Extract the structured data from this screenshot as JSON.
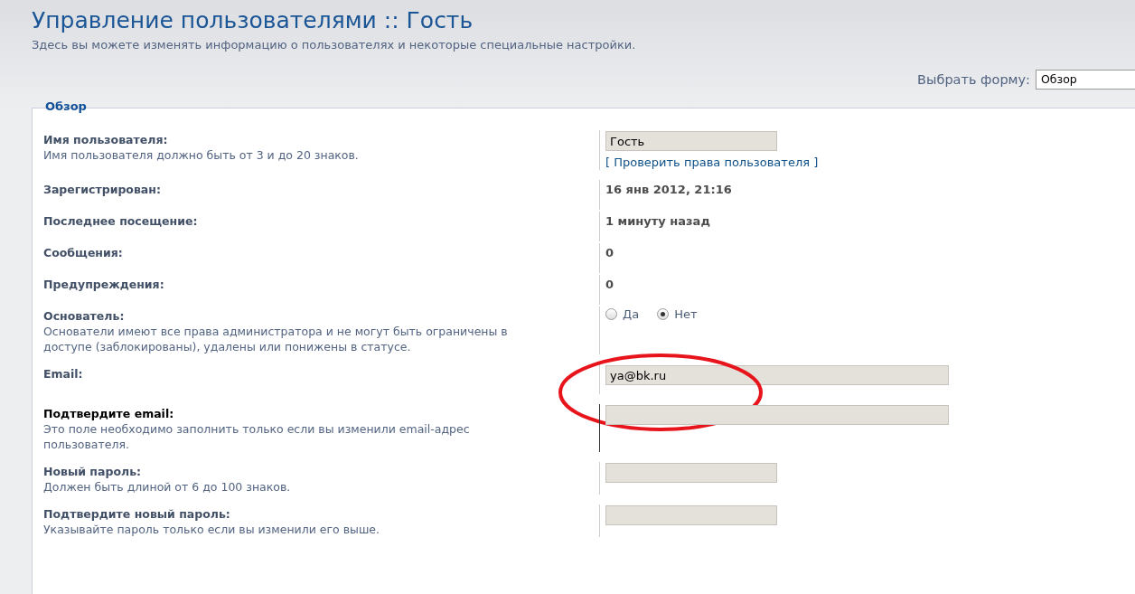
{
  "page": {
    "title": "Управление пользователями :: Гость",
    "subtitle": "Здесь вы можете изменять информацию о пользователях и некоторые специальные настройки."
  },
  "form_select": {
    "label": "Выбрать форму:",
    "value": "Обзор"
  },
  "panel": {
    "legend": "Обзор"
  },
  "rows": [
    {
      "kind": "input",
      "label": "Имя пользователя:",
      "hint": "Имя пользователя должно быть от 3 и до 20 знаков.",
      "value": "Гость",
      "link": "[ Проверить права пользователя ]",
      "active": false,
      "circled": false
    },
    {
      "kind": "text",
      "label": "Зарегистрирован:",
      "value": "16 янв 2012, 21:16",
      "active": false,
      "circled": false
    },
    {
      "kind": "text",
      "label": "Последнее посещение:",
      "value": "1 минуту назад",
      "active": false,
      "circled": false
    },
    {
      "kind": "text",
      "label": "Сообщения:",
      "value": "0",
      "active": false,
      "circled": false
    },
    {
      "kind": "text",
      "label": "Предупреждения:",
      "value": "0",
      "active": false,
      "circled": false
    },
    {
      "kind": "radio",
      "label": "Основатель:",
      "hint": "Основатели имеют все права администратора и не могут быть ограничены в доступе (заблокированы), удалены или понижены в статусе.",
      "options": [
        {
          "label": "Да",
          "selected": false
        },
        {
          "label": "Нет",
          "selected": true
        }
      ],
      "active": false,
      "circled": false
    },
    {
      "kind": "wide-input",
      "label": "Email:",
      "value": "ya@bk.ru",
      "active": false,
      "circled": true
    },
    {
      "kind": "wide-input",
      "label": "Подтвердите email:",
      "hint": "Это поле необходимо заполнить только если вы изменили email-адрес пользователя.",
      "active": true,
      "circled": false
    },
    {
      "kind": "input",
      "label": "Новый пароль:",
      "hint": "Должен быть длиной от 6 до 100 знаков.",
      "active": false,
      "circled": false
    },
    {
      "kind": "input",
      "label": "Подтвердите новый пароль:",
      "hint": "Указывайте пароль только если вы изменили его выше.",
      "active": false,
      "circled": false
    }
  ]
}
